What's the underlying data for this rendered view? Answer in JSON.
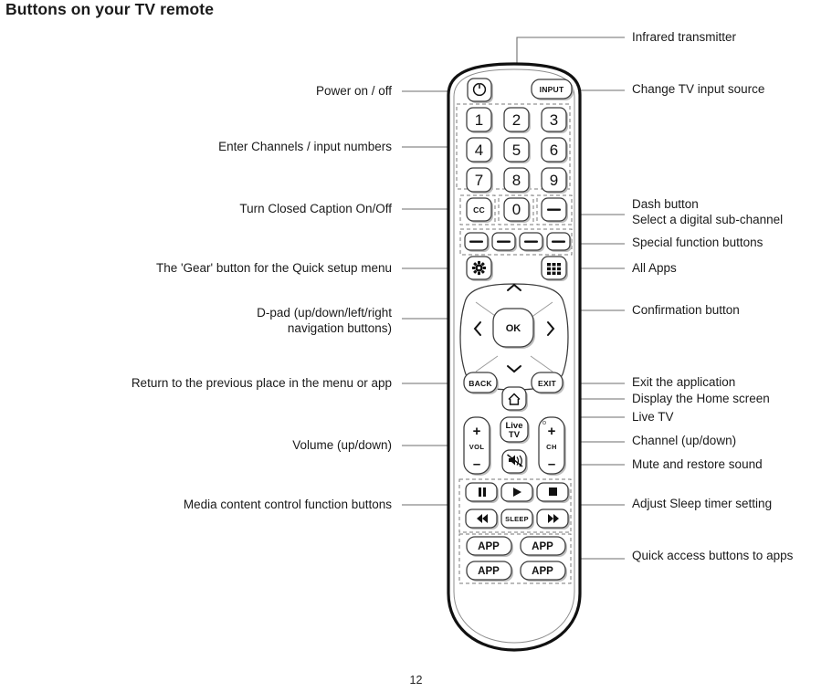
{
  "page": {
    "title": "Buttons on your TV remote",
    "number": "12"
  },
  "callouts_left": [
    {
      "id": "power",
      "text": "Power on / off"
    },
    {
      "id": "numbers",
      "text": "Enter Channels / input numbers"
    },
    {
      "id": "closedcaption",
      "text": "Turn Closed Caption On/Off"
    },
    {
      "id": "gear",
      "text": "The 'Gear' button for the Quick setup menu"
    },
    {
      "id": "dpad1",
      "text": "D-pad (up/down/left/right"
    },
    {
      "id": "dpad2",
      "text": "navigation buttons)"
    },
    {
      "id": "back",
      "text": "Return to the previous place in the menu or app"
    },
    {
      "id": "volume",
      "text": "Volume (up/down)"
    },
    {
      "id": "media",
      "text": "Media content control function buttons"
    }
  ],
  "callouts_right": [
    {
      "id": "infrared",
      "text": "Infrared transmitter"
    },
    {
      "id": "input",
      "text": "Change TV input source"
    },
    {
      "id": "dash",
      "text": "Dash button"
    },
    {
      "id": "subchan",
      "text": "Select a digital sub-channel"
    },
    {
      "id": "special",
      "text": "Special function buttons"
    },
    {
      "id": "allapps",
      "text": "All Apps"
    },
    {
      "id": "ok",
      "text": "Confirmation button"
    },
    {
      "id": "exit",
      "text": "Exit the application"
    },
    {
      "id": "home",
      "text": "Display the Home screen"
    },
    {
      "id": "livetv",
      "text": "Live TV"
    },
    {
      "id": "channel",
      "text": "Channel (up/down)"
    },
    {
      "id": "mute",
      "text": "Mute and restore sound"
    },
    {
      "id": "sleep",
      "text": "Adjust Sleep timer setting"
    },
    {
      "id": "apps",
      "text": "Quick access buttons to apps"
    }
  ],
  "remote": {
    "buttons": {
      "power_icon": "power-symbol",
      "input": "INPUT",
      "numbers": [
        "1",
        "2",
        "3",
        "4",
        "5",
        "6",
        "7",
        "8",
        "9"
      ],
      "zero": "0",
      "cc": "CC",
      "dash_key": "—",
      "special_keys": [
        "—",
        "—",
        "—",
        "—"
      ],
      "gear_icon": "gear-symbol",
      "allapps_icon": "grid-symbol",
      "dpad_up": "⌃",
      "dpad_down": "⌄",
      "dpad_left": "‹",
      "dpad_right": "›",
      "ok": "OK",
      "back": "BACK",
      "exit": "EXIT",
      "home_icon": "home-symbol",
      "vol_label": "VOL",
      "vol_plus": "+",
      "vol_minus": "–",
      "ch_label": "CH",
      "ch_plus": "+",
      "ch_minus": "–",
      "livetv_line1": "Live",
      "livetv_line2": "TV",
      "mute_icon": "mute-speaker",
      "pause_icon": "pause-symbol",
      "play_icon": "play-symbol",
      "stop_icon": "stop-symbol",
      "rewind_icon": "rewind-symbol",
      "forward_icon": "fast-forward-symbol",
      "sleep": "SLEEP",
      "app_buttons": [
        "APP",
        "APP",
        "APP",
        "APP"
      ]
    }
  },
  "colors": {
    "outline": "#111111",
    "leader": "#6e6e6e",
    "dashed_group": "#7a7a7a",
    "text": "#1a1a1a"
  }
}
